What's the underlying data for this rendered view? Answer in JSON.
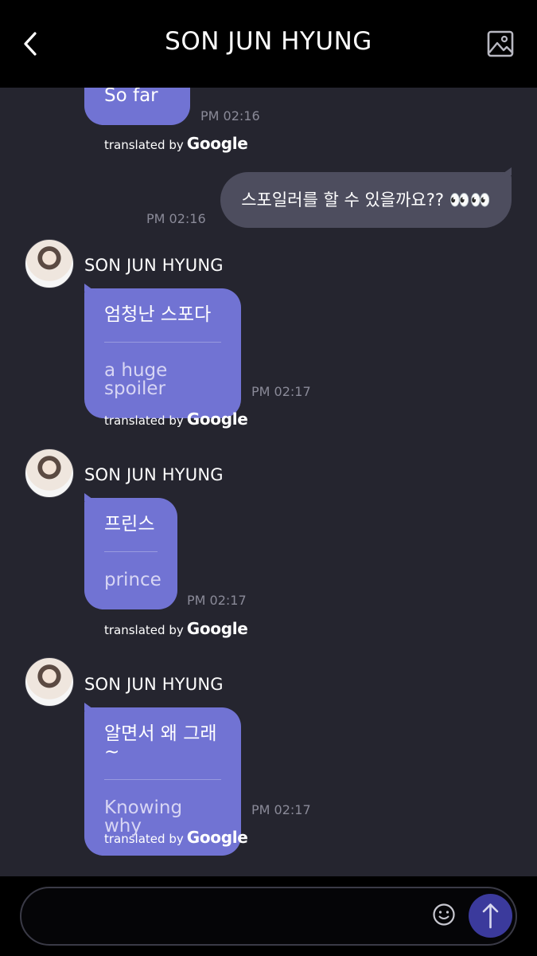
{
  "header": {
    "title": "SON JUN HYUNG",
    "back_icon": "chevron-left-icon",
    "gallery_icon": "image-icon"
  },
  "badge": {
    "translated_by": "translated by",
    "google": "Google"
  },
  "messages": [
    {
      "original": "So far",
      "time": "PM 02:16"
    },
    {
      "mine": true,
      "text": "스포일러를 할 수 있을까요?? 👀👀",
      "time": "PM 02:16"
    },
    {
      "sender": "SON JUN HYUNG",
      "original": "엄청난 스포다",
      "translation": "a huge spoiler",
      "time": "PM 02:17"
    },
    {
      "sender": "SON JUN HYUNG",
      "original": "프린스",
      "translation": "prince",
      "time": "PM 02:17"
    },
    {
      "sender": "SON JUN HYUNG",
      "original": "알면서 왜 그래~",
      "translation": "Knowing why",
      "time": "PM 02:17"
    }
  ],
  "input": {
    "placeholder": "",
    "emoji_icon": "smiley-icon",
    "send_icon": "arrow-up-icon"
  },
  "colors": {
    "background": "#25252f",
    "header": "#000000",
    "bubble_received": "#7173d3",
    "bubble_sent": "#4d4d5e",
    "send_button": "#3b3a9c",
    "timestamp": "#8a8a98"
  }
}
